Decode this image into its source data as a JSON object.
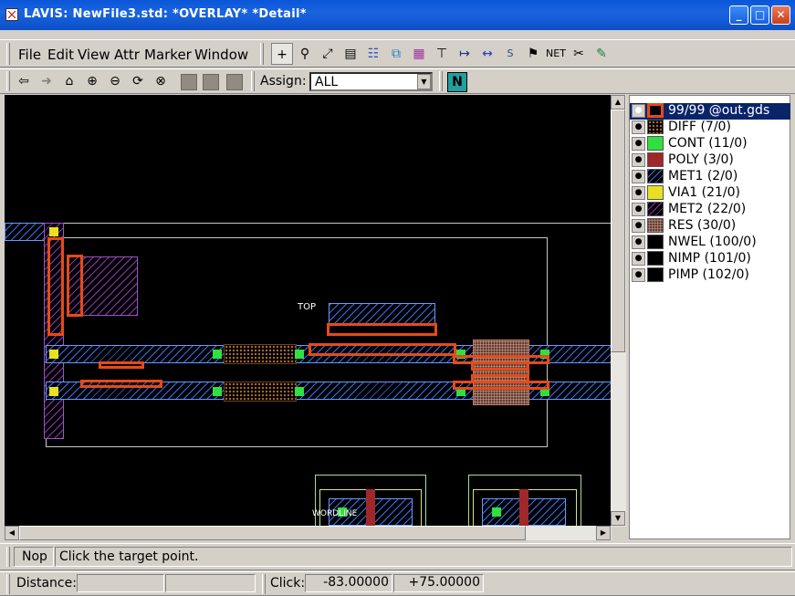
{
  "window": {
    "title": "LAVIS: NewFile3.std: *OVERLAY* *Detail*",
    "minimize": "_",
    "maximize": "□",
    "close": "✕"
  },
  "menu": {
    "file": "File",
    "edit": "Edit",
    "view": "View",
    "attr": "Attr",
    "marker": "Marker",
    "window": "Window"
  },
  "toolbar2": {
    "assign_label": "Assign:",
    "assign_value": "ALL",
    "n_button": "N"
  },
  "canvas": {
    "cell_label": "TOP",
    "bottom_label": "WORDLINE"
  },
  "layers": [
    {
      "label": "99/99 @out.gds",
      "color": "#e84a18",
      "selected": true
    },
    {
      "label": "DIFF (7/0)",
      "color": "#a86a30"
    },
    {
      "label": "CONT (11/0)",
      "color": "#30e040"
    },
    {
      "label": "POLY (3/0)",
      "color": "#a02828"
    },
    {
      "label": "MET1 (2/0)",
      "color": "#3a70e8"
    },
    {
      "label": "VIA1 (21/0)",
      "color": "#e8e020"
    },
    {
      "label": "MET2 (22/0)",
      "color": "#8a3ab0"
    },
    {
      "label": "RES (30/0)",
      "color": "#c09080"
    },
    {
      "label": "NWEL (100/0)",
      "color": "#000000"
    },
    {
      "label": "NIMP (101/0)",
      "color": "#000000"
    },
    {
      "label": "PIMP (102/0)",
      "color": "#000000"
    }
  ],
  "status": {
    "mode": "Nop",
    "message": "Click the target point.",
    "distance_label": "Distance:",
    "click_label": "Click:",
    "click_x": "-83.00000",
    "click_y": "+75.00000"
  }
}
